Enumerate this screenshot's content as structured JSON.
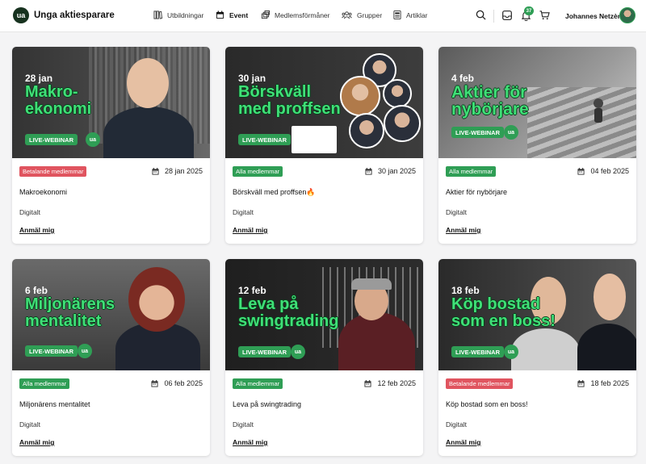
{
  "app": {
    "name": "Unga aktiesparare",
    "logo_mark": "ua"
  },
  "nav": [
    {
      "label": "Utbildningar",
      "icon": "books-icon",
      "active": false
    },
    {
      "label": "Event",
      "icon": "calendar-icon",
      "active": true
    },
    {
      "label": "Medlemsförmåner",
      "icon": "gift-icon",
      "active": false
    },
    {
      "label": "Grupper",
      "icon": "group-icon",
      "active": false
    },
    {
      "label": "Artiklar",
      "icon": "article-icon",
      "active": false
    }
  ],
  "header": {
    "notification_count": "37",
    "user_name": "Johannes Netzèn"
  },
  "live_label": "LIVE-WEBINAR",
  "events": [
    {
      "banner_date": "28 jan",
      "banner_title": "Makro-\nekonomi",
      "tag": "Betalande medlemmar",
      "tag_type": "paid",
      "date": "28 jan 2025",
      "title": "Makroekonomi",
      "location": "Digitalt",
      "cta": "Anmäl mig"
    },
    {
      "banner_date": "30 jan",
      "banner_title": "Börskväll\nmed proffsen",
      "tag": "Alla medlemmar",
      "tag_type": "all",
      "date": "30 jan 2025",
      "title": "Börskväll med proffsen🔥",
      "location": "Digitalt",
      "cta": "Anmäl mig"
    },
    {
      "banner_date": "4 feb",
      "banner_title": "Aktier för\nnybörjare",
      "tag": "Alla medlemmar",
      "tag_type": "all",
      "date": "04 feb 2025",
      "title": "Aktier för nybörjare",
      "location": "Digitalt",
      "cta": "Anmäl mig"
    },
    {
      "banner_date": "6 feb",
      "banner_title": "Miljonärens\nmentalitet",
      "tag": "Alla medlemmar",
      "tag_type": "all",
      "date": "06 feb 2025",
      "title": "Miljonärens mentalitet",
      "location": "Digitalt",
      "cta": "Anmäl mig"
    },
    {
      "banner_date": "12 feb",
      "banner_title": "Leva på\nswingtrading",
      "tag": "Alla medlemmar",
      "tag_type": "all",
      "date": "12 feb 2025",
      "title": "Leva på swingtrading",
      "location": "Digitalt",
      "cta": "Anmäl mig"
    },
    {
      "banner_date": "18 feb",
      "banner_title": "Köp bostad\nsom en boss!",
      "tag": "Betalande medlemmar",
      "tag_type": "paid",
      "date": "18 feb 2025",
      "title": "Köp bostad som en boss!",
      "location": "Digitalt",
      "cta": "Anmäl mig"
    }
  ],
  "colors": {
    "brand_green": "#2f9e55",
    "title_green": "#3fe077",
    "paid_red": "#e0545f",
    "logo_dark": "#17321f"
  }
}
